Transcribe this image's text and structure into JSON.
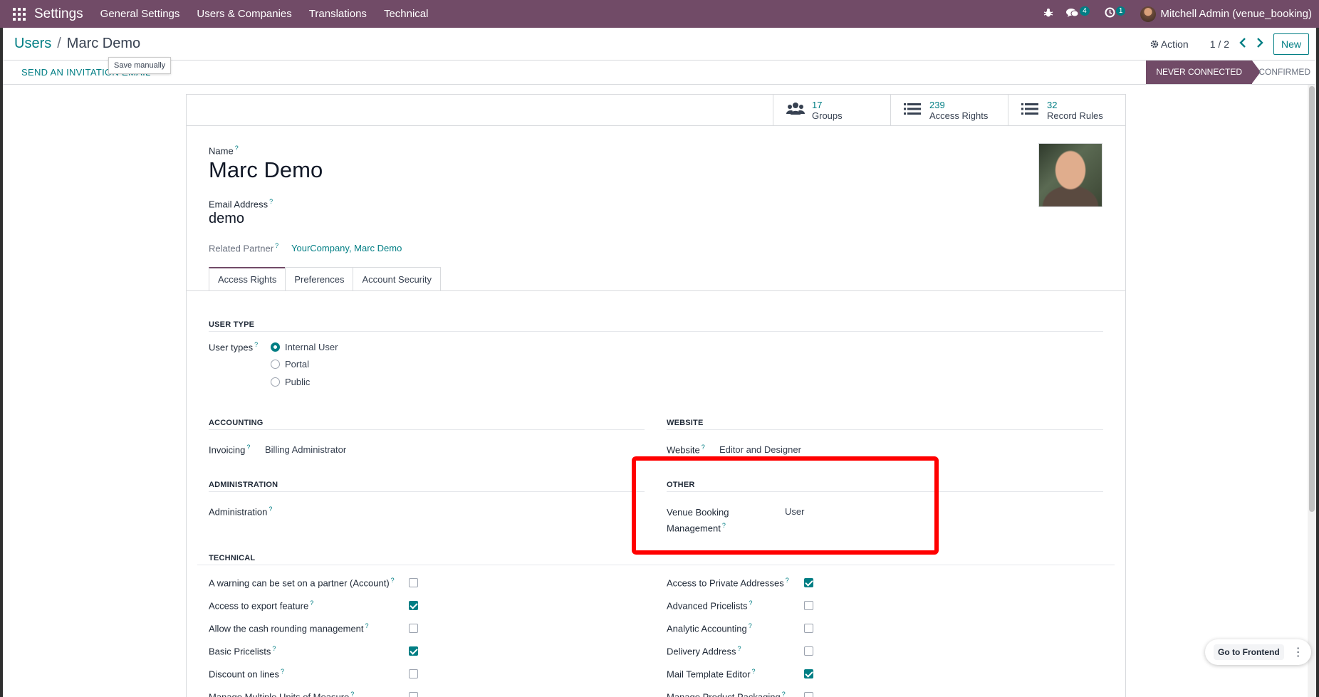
{
  "navbar": {
    "brand": "Settings",
    "menu": [
      "General Settings",
      "Users & Companies",
      "Translations",
      "Technical"
    ],
    "messages_badge": "4",
    "activities_badge": "1",
    "user": "Mitchell Admin (venue_booking)",
    "brand_color": "#714b67"
  },
  "control": {
    "breadcrumb_parent": "Users",
    "breadcrumb_sep": "/",
    "breadcrumb_current": "Marc Demo",
    "action_label": "Action",
    "pager": "1 / 2",
    "new_label": "New"
  },
  "statusbar": {
    "invite_label": "SEND AN INVITATION EMAIL",
    "tooltip": "Save manually",
    "stage_active": "NEVER CONNECTED",
    "stage_next": "CONFIRMED"
  },
  "stats": [
    {
      "value": "17",
      "label": "Groups",
      "icon": "users-icon"
    },
    {
      "value": "239",
      "label": "Access Rights",
      "icon": "list-icon"
    },
    {
      "value": "32",
      "label": "Record Rules",
      "icon": "list-icon"
    }
  ],
  "form": {
    "name_label": "Name",
    "name_value": "Marc Demo",
    "email_label": "Email Address",
    "email_value": "demo",
    "partner_label": "Related Partner",
    "partner_value": "YourCompany, Marc Demo",
    "help_mark": "?"
  },
  "tabs": [
    "Access Rights",
    "Preferences",
    "Account Security"
  ],
  "access": {
    "user_type_title": "USER TYPE",
    "user_types_label": "User types",
    "user_type_options": [
      "Internal User",
      "Portal",
      "Public"
    ],
    "accounting_title": "ACCOUNTING",
    "invoicing_label": "Invoicing",
    "invoicing_value": "Billing Administrator",
    "website_title": "WEBSITE",
    "website_label": "Website",
    "website_value": "Editor and Designer",
    "administration_title": "ADMINISTRATION",
    "administration_label": "Administration",
    "other_title": "OTHER",
    "venue_label_1": "Venue Booking",
    "venue_label_2": "Management",
    "venue_value": "User",
    "technical_title": "TECHNICAL",
    "technical_left": [
      {
        "label": "A warning can be set on a partner (Account)",
        "checked": false
      },
      {
        "label": "Access to export feature",
        "checked": true
      },
      {
        "label": "Allow the cash rounding management",
        "checked": false
      },
      {
        "label": "Basic Pricelists",
        "checked": true
      },
      {
        "label": "Discount on lines",
        "checked": false
      },
      {
        "label": "Manage Multiple Units of Measure",
        "checked": false
      }
    ],
    "technical_right": [
      {
        "label": "Access to Private Addresses",
        "checked": true
      },
      {
        "label": "Advanced Pricelists",
        "checked": false
      },
      {
        "label": "Analytic Accounting",
        "checked": false
      },
      {
        "label": "Delivery Address",
        "checked": false
      },
      {
        "label": "Mail Template Editor",
        "checked": true
      },
      {
        "label": "Manage Product Packaging",
        "checked": false
      }
    ]
  },
  "fab": {
    "label": "Go to Frontend"
  }
}
